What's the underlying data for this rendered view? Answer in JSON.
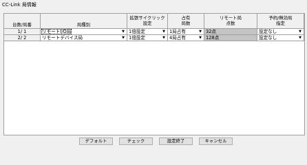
{
  "window": {
    "title": "CC-Link 局情報"
  },
  "table": {
    "headers": {
      "station_no": "台数/局番",
      "station_type": "局種別",
      "ext_cyclic_l1": "拡張サイクリック",
      "ext_cyclic_l2": "設定",
      "occupied_l1": "占有",
      "occupied_l2": "局数",
      "remote_points_l1": "リモート局",
      "remote_points_l2": "点数",
      "reserved_l1": "予約/無効局",
      "reserved_l2": "指定"
    },
    "rows": [
      {
        "station_no": "1/ 1",
        "station_type": "リモートI/O局",
        "ext_cyclic": "1倍設定",
        "occupied": "1局占有",
        "remote_points": "32点",
        "reserved": "設定なし"
      },
      {
        "station_no": "2/ 2",
        "station_type": "リモートデバイス局",
        "ext_cyclic": "1倍設定",
        "occupied": "4局占有",
        "remote_points": "128点",
        "reserved": "設定なし"
      }
    ],
    "dropdown_arrow": "▼"
  },
  "buttons": {
    "default": "デフォルト",
    "check": "チェック",
    "finish": "設定終了",
    "cancel": "キャンセル"
  }
}
